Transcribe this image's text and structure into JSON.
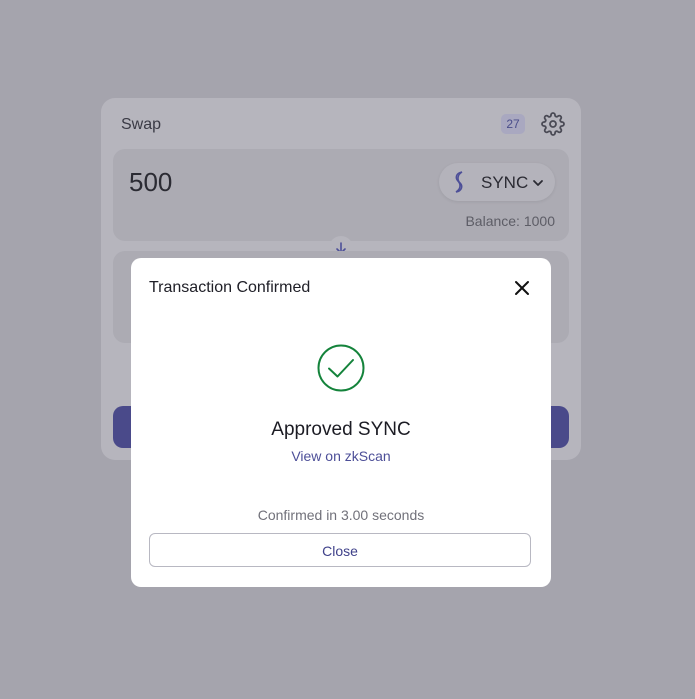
{
  "swap": {
    "title": "Swap",
    "block_number": "27",
    "icons": {
      "settings": "gear-icon",
      "token": "sync-token-icon",
      "dropdown": "chevron-down-icon",
      "switch": "arrow-down-icon"
    },
    "input": {
      "amount": "500",
      "token": "SYNC",
      "balance": "Balance: 1000"
    }
  },
  "modal": {
    "title": "Transaction Confirmed",
    "status": "Approved SYNC",
    "link": "View on zkScan",
    "confirmed": "Confirmed in 3.00 seconds",
    "close_label": "Close",
    "icons": {
      "close": "close-icon",
      "status": "check-circle-icon"
    }
  },
  "colors": {
    "accent": "#4d4f98",
    "success": "#14833b",
    "overlay": "#a5a4ad"
  }
}
